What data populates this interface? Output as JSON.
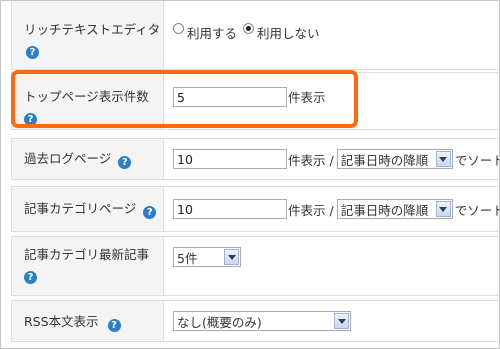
{
  "settings": {
    "rich_text_editor": {
      "label": "リッチテキストエディタ",
      "options": [
        {
          "label": "利用する",
          "selected": false
        },
        {
          "label": "利用しない",
          "selected": true
        }
      ]
    },
    "top_page_count": {
      "label": "トップページ表示件数",
      "value": "5",
      "suffix": "件表示"
    },
    "archive_page": {
      "label": "過去ログページ",
      "value": "10",
      "suffix": "件表示 /",
      "sort_selected": "記事日時の降順",
      "trailing": "でソート"
    },
    "category_page": {
      "label": "記事カテゴリページ",
      "value": "10",
      "suffix": "件表示 /",
      "sort_selected": "記事日時の降順",
      "trailing": "でソート"
    },
    "category_latest": {
      "label": "記事カテゴリ最新記事",
      "selected": "5件"
    },
    "rss_body": {
      "label": "RSS本文表示",
      "selected": "なし(概要のみ)"
    }
  },
  "help_icon_glyph": "?",
  "colors": {
    "highlight_border": "#ff6a10",
    "help_icon": "#2a7fc8",
    "label_bg": "#f4f4f4"
  }
}
